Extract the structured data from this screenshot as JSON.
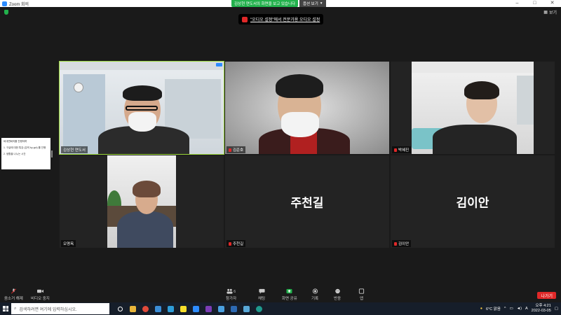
{
  "window": {
    "title": "Zoom 회의",
    "controls": [
      "–",
      "□",
      "✕"
    ]
  },
  "share_banner": {
    "text": "김상현 연도서의 화면을 보고 있습니다",
    "view_options": "옵션 보기"
  },
  "top_right": {
    "view_label": "보기"
  },
  "audio_tip": {
    "text": "\"오디오 설정\"에서 전문가용 오디오 설정"
  },
  "participants": [
    {
      "name": "김상현 연도서",
      "muted": false,
      "video": true,
      "active": true
    },
    {
      "name": "김준호",
      "muted": true,
      "video": true
    },
    {
      "name": "박혜진",
      "muted": true,
      "video": true
    },
    {
      "name": "오명옥",
      "muted": false,
      "video": true
    },
    {
      "name": "주천길",
      "muted": true,
      "video": false,
      "display": "주천길"
    },
    {
      "name": "김이안",
      "muted": true,
      "video": false,
      "display": "김이안"
    }
  ],
  "shared_doc": {
    "lines": [
      "비대면회의를 진행하며",
      "1. 구글에 대한 특강 (강의 by ppt) 를 진행",
      "2. 생활을 나누는 시간"
    ]
  },
  "toolbar": {
    "items": [
      {
        "label": "음소거 해제",
        "icon": "mic-muted-icon"
      },
      {
        "label": "비디오 중지",
        "icon": "video-camera-icon"
      },
      {
        "label": "참가자",
        "icon": "participants-icon",
        "count": "6"
      },
      {
        "label": "채팅",
        "icon": "chat-icon"
      },
      {
        "label": "화면 공유",
        "icon": "share-screen-icon"
      },
      {
        "label": "기록",
        "icon": "record-icon"
      },
      {
        "label": "반응",
        "icon": "reaction-icon"
      },
      {
        "label": "앱",
        "icon": "apps-icon"
      }
    ],
    "leave": "나가기"
  },
  "taskbar": {
    "search_placeholder": "검색하려면 여기에 입력하십시오.",
    "weather": "6°C 맑음",
    "lang": "A",
    "time": "오후 4:21",
    "date": "2022-03-05"
  },
  "colors": {
    "share_green": "#22b14c",
    "active_border": "#9bd83a",
    "leave_red": "#e02828",
    "zoom_blue": "#2d8cff"
  }
}
